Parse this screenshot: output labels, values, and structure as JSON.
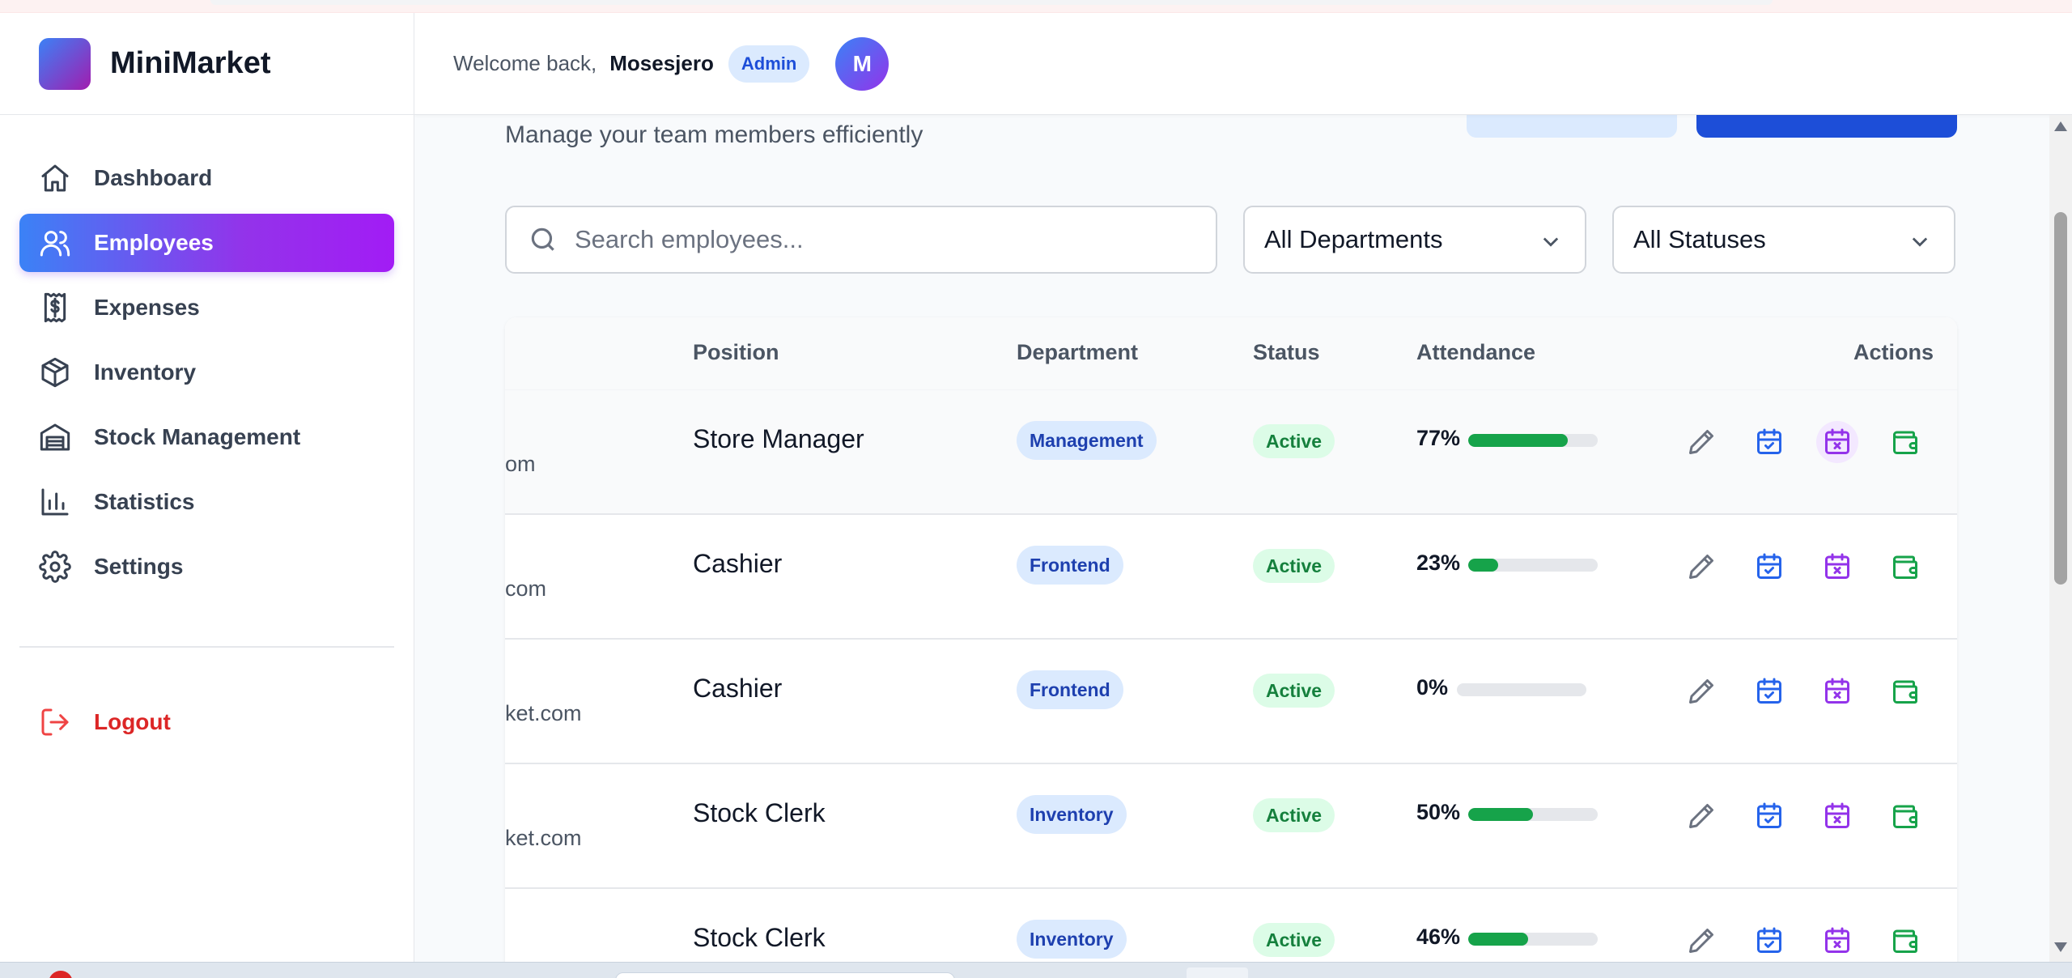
{
  "brand": {
    "name": "MiniMarket"
  },
  "sidebar": {
    "items": [
      {
        "label": "Dashboard",
        "icon": "home-icon"
      },
      {
        "label": "Employees",
        "icon": "users-icon",
        "active": true
      },
      {
        "label": "Expenses",
        "icon": "receipt-icon"
      },
      {
        "label": "Inventory",
        "icon": "box-icon"
      },
      {
        "label": "Stock Management",
        "icon": "warehouse-icon"
      },
      {
        "label": "Statistics",
        "icon": "bar-chart-icon"
      },
      {
        "label": "Settings",
        "icon": "gear-icon"
      }
    ],
    "logout": {
      "label": "Logout",
      "icon": "logout-icon"
    }
  },
  "header": {
    "welcome": "Welcome back,",
    "username": "Mosesjero",
    "role": "Admin",
    "avatar_initial": "M"
  },
  "page": {
    "subtitle": "Manage your team members efficiently"
  },
  "filters": {
    "search_placeholder": "Search employees...",
    "department": "All Departments",
    "status": "All Statuses"
  },
  "table": {
    "columns": {
      "position": "Position",
      "department": "Department",
      "status": "Status",
      "attendance": "Attendance",
      "actions": "Actions"
    },
    "rows": [
      {
        "email": "om",
        "position": "Store Manager",
        "department": "Management",
        "status": "Active",
        "attendance": "77%",
        "attendance_value": 77
      },
      {
        "email": "com",
        "position": "Cashier",
        "department": "Frontend",
        "status": "Active",
        "attendance": "23%",
        "attendance_value": 23
      },
      {
        "email": "ket.com",
        "position": "Cashier",
        "department": "Frontend",
        "status": "Active",
        "attendance": "0%",
        "attendance_value": 0
      },
      {
        "email": "ket.com",
        "position": "Stock Clerk",
        "department": "Inventory",
        "status": "Active",
        "attendance": "50%",
        "attendance_value": 50
      },
      {
        "email": "",
        "position": "Stock Clerk",
        "department": "Inventory",
        "status": "Active",
        "attendance": "46%",
        "attendance_value": 46
      }
    ]
  },
  "colors": {
    "accent_gradient_start": "#3b82f6",
    "accent_gradient_end": "#a21cf5",
    "primary_button": "#1d4ed8",
    "attendance_fill": "#16a34a",
    "logout": "#dc2626"
  }
}
